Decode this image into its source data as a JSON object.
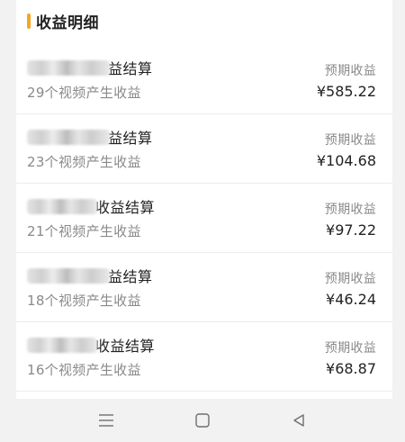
{
  "section": {
    "title": "收益明细"
  },
  "rows": [
    {
      "title": "益结算",
      "subtitle": "29个视频产生收益",
      "amount_label": "预期收益",
      "amount": "¥585.22"
    },
    {
      "title": "益结算",
      "subtitle": "23个视频产生收益",
      "amount_label": "预期收益",
      "amount": "¥104.68"
    },
    {
      "title": "收益结算",
      "subtitle": "21个视频产生收益",
      "amount_label": "预期收益",
      "amount": "¥97.22"
    },
    {
      "title": "益结算",
      "subtitle": "18个视频产生收益",
      "amount_label": "预期收益",
      "amount": "¥46.24"
    },
    {
      "title": "收益结算",
      "subtitle": "16个视频产生收益",
      "amount_label": "预期收益",
      "amount": "¥68.87"
    }
  ],
  "colors": {
    "accent": "#f5a623",
    "text_primary": "#222222",
    "text_secondary": "#8a8a8a",
    "background": "#f2f2f2",
    "card": "#ffffff"
  },
  "nav": {
    "icons": [
      "menu-icon",
      "home-square-icon",
      "back-triangle-icon"
    ]
  }
}
